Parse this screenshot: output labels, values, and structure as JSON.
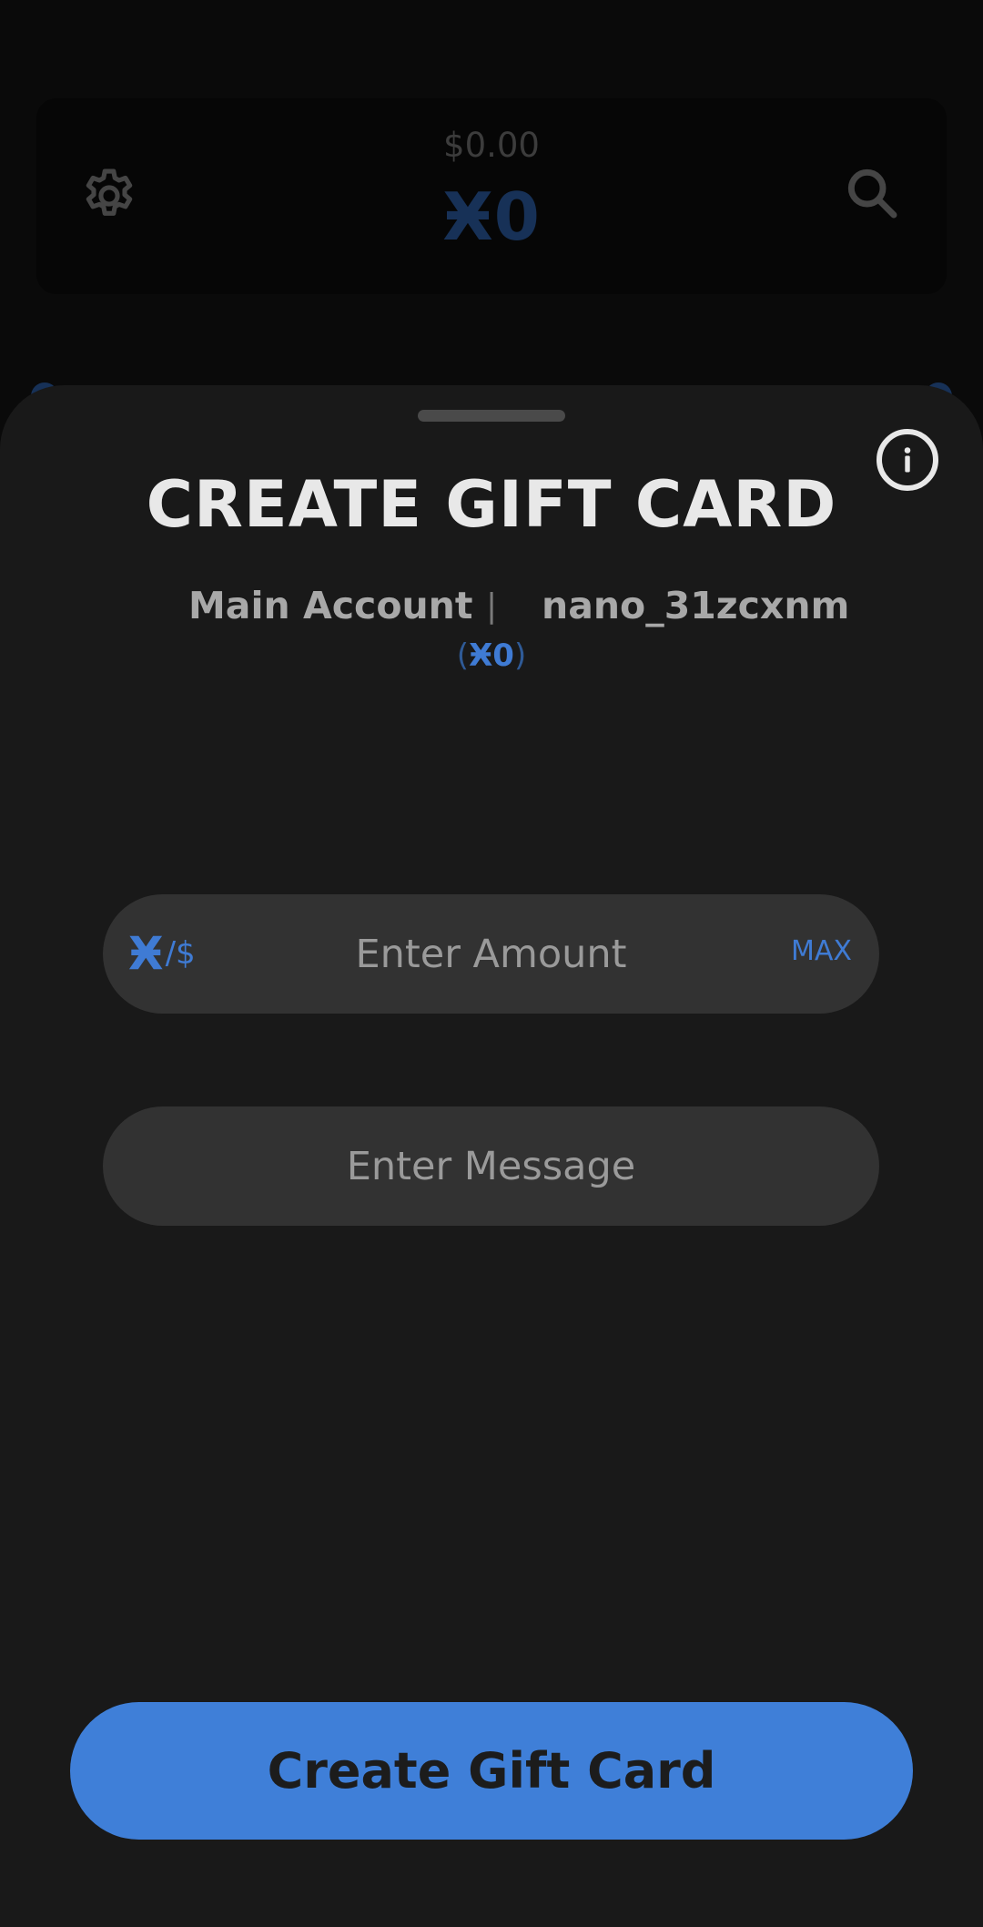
{
  "header": {
    "fiat_balance": "$0.00",
    "nano_balance": "Ӿ0"
  },
  "sheet": {
    "title": "CREATE GIFT CARD",
    "account": {
      "name": "Main Account",
      "separator": "|",
      "address": "nano_31zcxnm",
      "balance_open": "(",
      "balance": "Ӿ0",
      "balance_close": ")"
    },
    "amount_field": {
      "placeholder": "Enter Amount",
      "currency_primary": "Ӿ",
      "currency_secondary": "/$",
      "max_label": "MAX"
    },
    "message_field": {
      "placeholder": "Enter Message"
    },
    "create_button_label": "Create Gift Card"
  },
  "icons": {
    "settings": "gear-icon",
    "search": "search-icon",
    "info": "info-icon"
  },
  "colors": {
    "accent": "#3f7fd8",
    "sheet_background": "#191919",
    "field_background": "#323232",
    "dim_nano": "#173157"
  }
}
